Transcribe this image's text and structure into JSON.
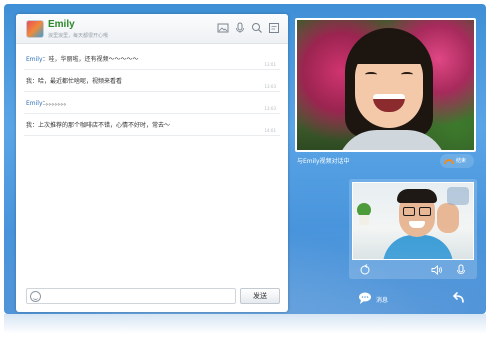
{
  "contact": {
    "name": "Emily",
    "status": "浪里浪里，每天都很开心哦"
  },
  "header_icons": [
    "image-icon",
    "microphone-icon",
    "pen-icon",
    "more-icon"
  ],
  "messages": [
    {
      "sender": "Emily",
      "text": "：哇，华丽啦，还有视频～～～～～",
      "time": "13:01"
    },
    {
      "sender": "我",
      "text": "：哈，最近都忙啥呢，视频来看看",
      "time": "13:03"
    },
    {
      "sender": "Emily",
      "text": "：。。。。。。。",
      "time": "13:03"
    },
    {
      "sender": "我",
      "text": "：上次推荐的那个咖啡店不错，心情不好时，常去～",
      "time": "14:01"
    }
  ],
  "input": {
    "placeholder": "",
    "send_label": "发送"
  },
  "video": {
    "status_text": "与Emily视频对话中",
    "end_label": "结束"
  },
  "message_bar": {
    "messages_label": "消息"
  },
  "colors": {
    "accent_blue": "#3f8fd6",
    "name_green": "#2a8a2a",
    "end_orange": "#f28b20"
  }
}
